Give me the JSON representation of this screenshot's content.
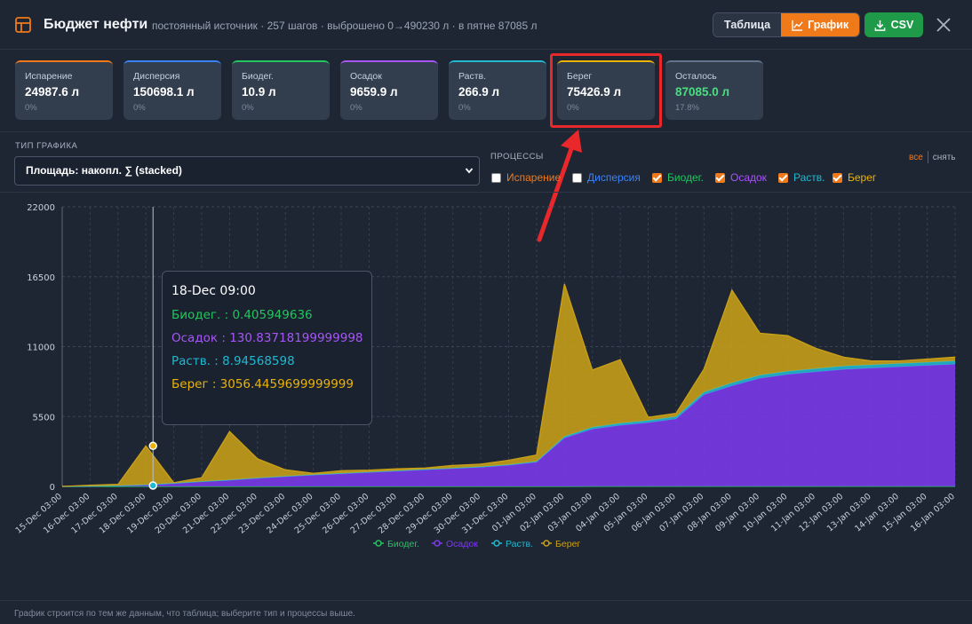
{
  "header": {
    "title": "Бюджет нефти",
    "subtitle": "постоянный источник · 257 шагов · выброшено 0→490230 л · в пятне 87085 л",
    "view_table": "Таблица",
    "view_chart": "График",
    "csv": "CSV"
  },
  "cards": [
    {
      "label": "Испарение",
      "value": "24987.6 л",
      "pct": "0%",
      "color": "#f07a1a"
    },
    {
      "label": "Дисперсия",
      "value": "150698.1 л",
      "pct": "0%",
      "color": "#3b82f6"
    },
    {
      "label": "Биодег.",
      "value": "10.9 л",
      "pct": "0%",
      "color": "#22c55e"
    },
    {
      "label": "Осадок",
      "value": "9659.9 л",
      "pct": "0%",
      "color": "#a855f7"
    },
    {
      "label": "Раств.",
      "value": "266.9 л",
      "pct": "0%",
      "color": "#22b8cf"
    },
    {
      "label": "Берег",
      "value": "75426.9 л",
      "pct": "0%",
      "color": "#eab308"
    },
    {
      "label": "Осталось",
      "value": "87085.0 л",
      "pct": "17.8%",
      "color": "#64748b",
      "value_color": "#4ade80"
    }
  ],
  "controls": {
    "chart_type_label": "ТИП ГРАФИКА",
    "chart_type_value": "Площадь: накопл. ∑ (stacked)",
    "processes_label": "ПРОЦЕССЫ",
    "all": "все",
    "clear": "снять",
    "processes": [
      {
        "label": "Испарение",
        "checked": false,
        "color": "#f07a1a"
      },
      {
        "label": "Дисперсия",
        "checked": false,
        "color": "#3b82f6"
      },
      {
        "label": "Биодег.",
        "checked": true,
        "color": "#22c55e"
      },
      {
        "label": "Осадок",
        "checked": true,
        "color": "#a855f7"
      },
      {
        "label": "Раств.",
        "checked": true,
        "color": "#22b8cf"
      },
      {
        "label": "Берег",
        "checked": true,
        "color": "#eab308"
      }
    ]
  },
  "tooltip": {
    "time": "18-Dec 09:00",
    "rows": [
      {
        "label": "Биодег. : 0.405949636",
        "color": "#22c55e"
      },
      {
        "label": "Осадок : 130.83718199999998",
        "color": "#a855f7"
      },
      {
        "label": "Раств. : 8.94568598",
        "color": "#22b8cf"
      },
      {
        "label": "Берег : 3056.4459699999999",
        "color": "#eab308"
      }
    ]
  },
  "chart_data": {
    "type": "area",
    "stacked": true,
    "ylim": [
      0,
      22000
    ],
    "yticks": [
      "0",
      "5500",
      "11000",
      "16500",
      "22000"
    ],
    "categories": [
      "15-Dec 03:00",
      "16-Dec 03:00",
      "17-Dec 03:00",
      "18-Dec 03:00",
      "19-Dec 03:00",
      "20-Dec 03:00",
      "21-Dec 03:00",
      "22-Dec 03:00",
      "23-Dec 03:00",
      "24-Dec 03:00",
      "25-Dec 03:00",
      "26-Dec 03:00",
      "27-Dec 03:00",
      "28-Dec 03:00",
      "29-Dec 03:00",
      "30-Dec 03:00",
      "31-Dec 03:00",
      "01-Jan 03:00",
      "02-Jan 03:00",
      "03-Jan 03:00",
      "04-Jan 03:00",
      "05-Jan 03:00",
      "06-Jan 03:00",
      "07-Jan 03:00",
      "08-Jan 03:00",
      "09-Jan 03:00",
      "10-Jan 03:00",
      "11-Jan 03:00",
      "12-Jan 03:00",
      "13-Jan 03:00",
      "14-Jan 03:00",
      "15-Jan 03:00",
      "16-Jan 03:00"
    ],
    "legend_position": "bottom",
    "grid": true,
    "series": [
      {
        "name": "Биодег.",
        "color": "#22c55e",
        "total": [
          0,
          0,
          1,
          1,
          1,
          1,
          1,
          1,
          1,
          1,
          1,
          1,
          1,
          1,
          1,
          1,
          2,
          2,
          3,
          5,
          5,
          5,
          5,
          6,
          7,
          8,
          8,
          8,
          8,
          9,
          9,
          9,
          9
        ]
      },
      {
        "name": "Осадок",
        "color": "#7c3aed",
        "total": [
          0,
          20,
          60,
          130,
          250,
          380,
          500,
          650,
          780,
          900,
          1000,
          1100,
          1200,
          1300,
          1400,
          1500,
          1650,
          1900,
          3800,
          4500,
          4800,
          5000,
          5300,
          7200,
          7900,
          8500,
          8800,
          9000,
          9200,
          9300,
          9400,
          9500,
          9600
        ]
      },
      {
        "name": "Раств.",
        "color": "#22b8cf",
        "total": [
          0,
          0,
          2,
          5,
          8,
          12,
          16,
          20,
          24,
          28,
          32,
          36,
          40,
          44,
          48,
          52,
          60,
          70,
          120,
          150,
          170,
          180,
          190,
          220,
          240,
          250,
          255,
          258,
          260,
          262,
          264,
          265,
          266
        ]
      },
      {
        "name": "Берег",
        "color": "#c9a018",
        "total": [
          0,
          80,
          100,
          3056,
          30,
          300,
          3800,
          1500,
          500,
          100,
          200,
          150,
          150,
          100,
          200,
          200,
          350,
          500,
          12000,
          4500,
          5000,
          250,
          250,
          1800,
          7300,
          3300,
          2800,
          1600,
          700,
          300,
          200,
          250,
          300
        ]
      }
    ]
  }
}
